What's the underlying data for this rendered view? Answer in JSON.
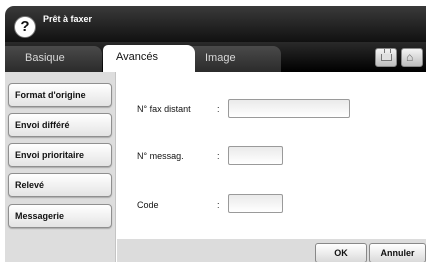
{
  "window": {
    "title": "Prêt à faxer",
    "help_icon": "?"
  },
  "tabs": [
    {
      "label": "Basique",
      "active": false
    },
    {
      "label": "Avancés",
      "active": true
    },
    {
      "label": "Image",
      "active": false
    }
  ],
  "toolbar_icons": {
    "tray": "tray-icon",
    "home": "home-icon",
    "home_glyph": "⌂"
  },
  "sidebar": {
    "items": [
      {
        "label": "Format d'origine"
      },
      {
        "label": "Envoi différé"
      },
      {
        "label": "Envoi prioritaire"
      },
      {
        "label": "Relevé"
      },
      {
        "label": "Messagerie"
      }
    ]
  },
  "form": {
    "fields": [
      {
        "label": "N° fax distant",
        "colon": ":",
        "value": ""
      },
      {
        "label": "N° messag.",
        "colon": ":",
        "value": ""
      },
      {
        "label": "Code",
        "colon": ":",
        "value": ""
      }
    ]
  },
  "actions": {
    "ok_label": "OK",
    "cancel_label": "Annuler"
  }
}
